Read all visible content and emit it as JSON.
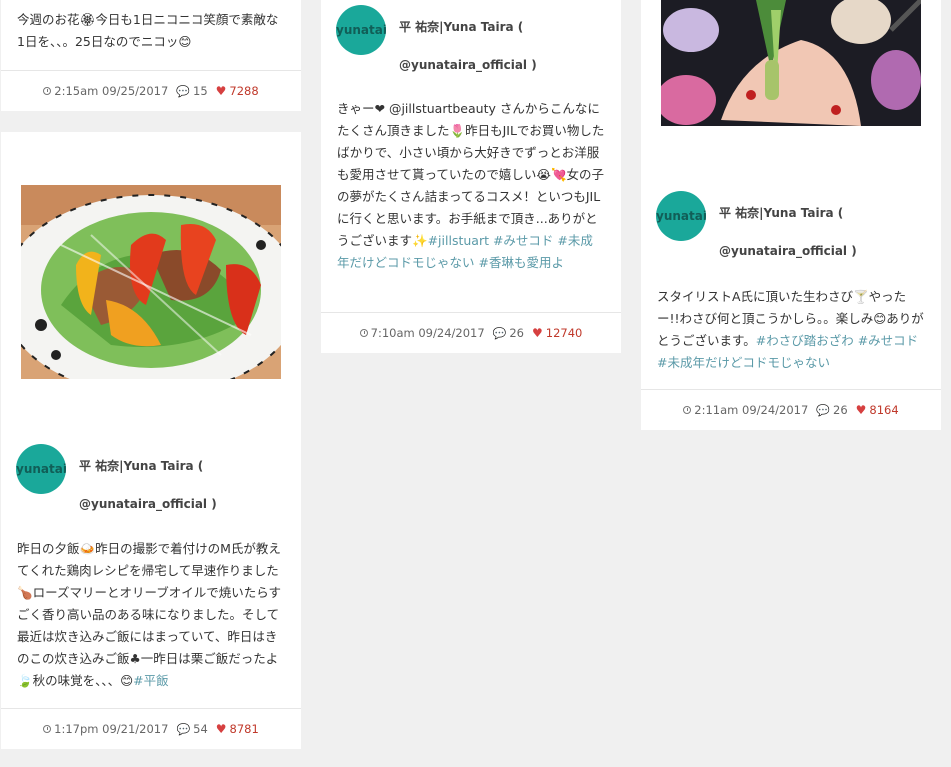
{
  "author": {
    "name_line1": "平 祐奈|Yuna Taira (",
    "name_line2": "@yunataira_official )",
    "avatar_text": "yunatai"
  },
  "cards": {
    "c1": {
      "text": "今週のお花🏵今日も1日ニコニコ笑顔で素敵な1日を、、。25日なのでニコッ😊",
      "time": "2:15am 09/25/2017",
      "comments": "15",
      "likes": "7288"
    },
    "c2": {
      "text": "昨日の夕飯🍛昨日の撮影で着付けのM氏が教えてくれた鶏肉レシピを帰宅して早速作りました🍗ローズマリーとオリーブオイルで焼いたらすごく香り高い品のある味になりました。そして最近は炊き込みご飯にはまっていて、昨日はきのこの炊き込みご飯♣一昨日は栗ご飯だったよ🍃秋の味覚を、、、😊",
      "tags": "#平飯",
      "time": "1:17pm 09/21/2017",
      "comments": "54",
      "likes": "8781"
    },
    "c3": {
      "text": "きゃー❤ @jillstuartbeauty さんからこんなにたくさん頂きました🌷昨日もJILでお買い物したばかりで、小さい頃から大好きでずっとお洋服も愛用させて貰っていたので嬉しい😭💘女の子の夢がたくさん詰まってるコスメ！といつもJILに行くと思います。お手紙まで頂き...ありがとうございます✨",
      "tags": "#jillstuart #みせコド #未成年だけどコドモじゃない #香琳も愛用よ",
      "time": "7:10am 09/24/2017",
      "comments": "26",
      "likes": "12740"
    },
    "c4": {
      "text": "スタイリストA氏に頂いた生わさび🍸やったー!!わさび何と頂こうかしら。。楽しみ😊ありがとうございます。",
      "tags": "#わさび踏おざわ #みせコド #未成年だけどコドモじゃない",
      "time": "2:11am 09/24/2017",
      "comments": "26",
      "likes": "8164"
    }
  }
}
